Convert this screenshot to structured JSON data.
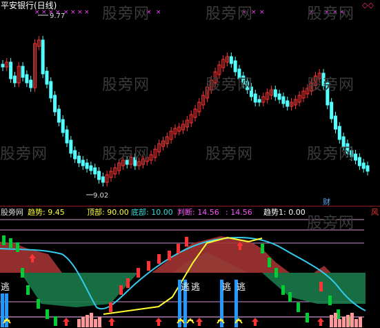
{
  "upper_panel": {
    "title": "平安银行(日线)",
    "high_label": "9.77",
    "low_label": "9.02",
    "cai_badge": "财",
    "diamond_marks": "◇◇"
  },
  "indicator_bar": {
    "left_name": "股旁网",
    "trend_label": "趋势",
    "trend_value": "9.45",
    "top_label": "顶部",
    "top_value": "90.00",
    "bottom_label": "底部",
    "bottom_value": "10.00",
    "judge_label": "判断",
    "judge_value": "14.56",
    "colon_value": "14.56",
    "trend1_label": "趋势1",
    "trend1_value": "0.00",
    "right_mark": "风"
  },
  "watermark_text": "股旁网",
  "escape_label": "逃",
  "colors": {
    "up": "#ff3333",
    "down": "#54ffff",
    "sell_green": "#00cc33",
    "area_red": "#a33333",
    "area_green": "#1a7a4a",
    "cyan_line": "#33ccee",
    "yellow_line": "#ffff33",
    "marker_magenta": "#ff44ff"
  }
}
